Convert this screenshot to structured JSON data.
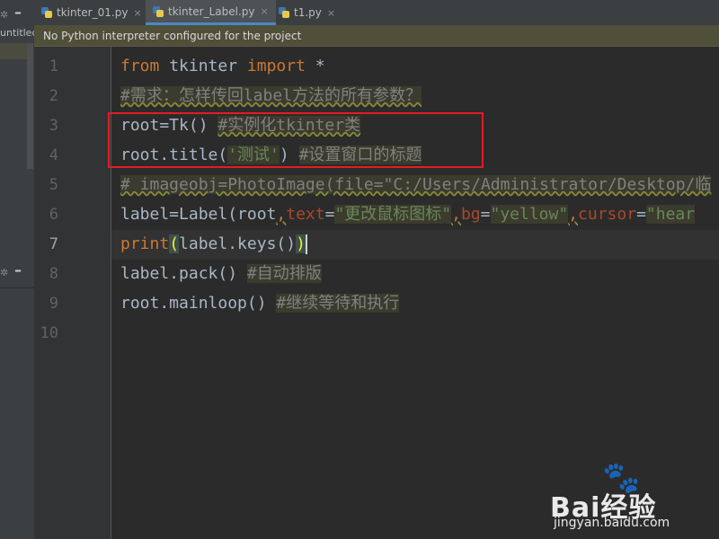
{
  "left_panel": {
    "project_label": "untitled"
  },
  "tabs": [
    {
      "label": "tkinter_01.py",
      "close": "×",
      "active": false
    },
    {
      "label": "tkinter_Label.py",
      "close": "×",
      "active": true
    },
    {
      "label": "t1.py",
      "close": "×",
      "active": false
    }
  ],
  "banner": {
    "text": "No Python interpreter configured for the project"
  },
  "gutter": {
    "line_numbers": [
      "1",
      "2",
      "3",
      "4",
      "5",
      "6",
      "7",
      "8",
      "9",
      "10"
    ],
    "current_line": 7
  },
  "code": {
    "l1_from": "from",
    "l1_mod": " tkinter ",
    "l1_import": "import",
    "l1_star": " *",
    "l2_comment": "#需求：怎样传回label方法的所有参数？",
    "l3_code": "root=Tk()",
    "l3_comment": "#实例化tkinter类",
    "l4_code": "root.title(",
    "l4_str": "'测试'",
    "l4_close": ")",
    "l4_comment": "#设置窗口的标题",
    "l5_comment": "# imageobj=PhotoImage(file=\"C:/Users/Administrator/Desktop/临",
    "l6_a": "label=Label(root",
    "l6_comma1": ",",
    "l6_text": "text",
    "l6_eq1": "=",
    "l6_str1": "\"更改鼠标图标\"",
    "l6_comma2": ",",
    "l6_bg": "bg",
    "l6_eq2": "=",
    "l6_str2": "\"yellow\"",
    "l6_comma3": ",",
    "l6_cursor": "cursor",
    "l6_eq3": "=",
    "l6_str3": "\"hear",
    "l7_print": "print",
    "l7_open": "(",
    "l7_mid": "label.keys()",
    "l7_close": ")",
    "l8_code": "label.pack()",
    "l8_comment": "#自动排版",
    "l9_code": "root.mainloop()",
    "l9_comment": "#继续等待和执行"
  },
  "watermark": {
    "brand": "Bai经验",
    "url": "jingyan.baidu.com"
  },
  "colors": {
    "editor_bg": "#2b2b2b",
    "keyword": "#cc7832",
    "comment": "#808080",
    "string": "#6a8759",
    "annotation_box": "#e51c24"
  }
}
